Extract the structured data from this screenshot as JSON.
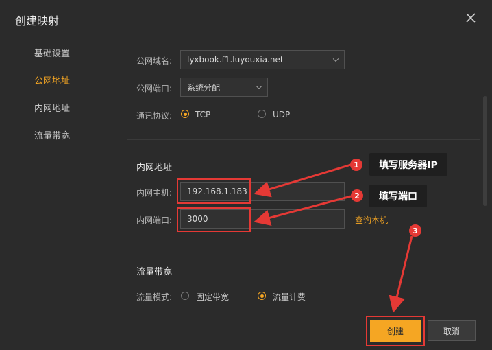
{
  "dialog": {
    "title": "创建映射",
    "close_icon": "close-icon"
  },
  "sidebar": {
    "items": [
      {
        "label": "基础设置",
        "active": false
      },
      {
        "label": "公网地址",
        "active": true
      },
      {
        "label": "内网地址",
        "active": false
      },
      {
        "label": "流量带宽",
        "active": false
      }
    ]
  },
  "public": {
    "domain_label": "公网域名:",
    "domain_value": "lyxbook.f1.luyouxia.net",
    "port_label": "公网端口:",
    "port_value": "系统分配",
    "protocol_label": "通讯协议:",
    "protocol_options": [
      "TCP",
      "UDP"
    ],
    "protocol_selected": "TCP"
  },
  "lan": {
    "section_title": "内网地址",
    "host_label": "内网主机:",
    "host_value": "192.168.1.183",
    "port_label": "内网端口:",
    "port_value": "3000",
    "query_link": "查询本机"
  },
  "bandwidth": {
    "section_title": "流量带宽",
    "mode_label": "流量模式:",
    "mode_options": [
      "固定带宽",
      "流量计费"
    ],
    "mode_selected": "流量计费"
  },
  "annotations": {
    "badges": [
      "1",
      "2",
      "3"
    ],
    "callouts": [
      "填写服务器IP",
      "填写端口"
    ],
    "color": "#e53935"
  },
  "footer": {
    "create_label": "创建",
    "cancel_label": "取消"
  },
  "colors": {
    "accent": "#f5a623",
    "background": "#2b2b2b",
    "annotation": "#e53935"
  }
}
